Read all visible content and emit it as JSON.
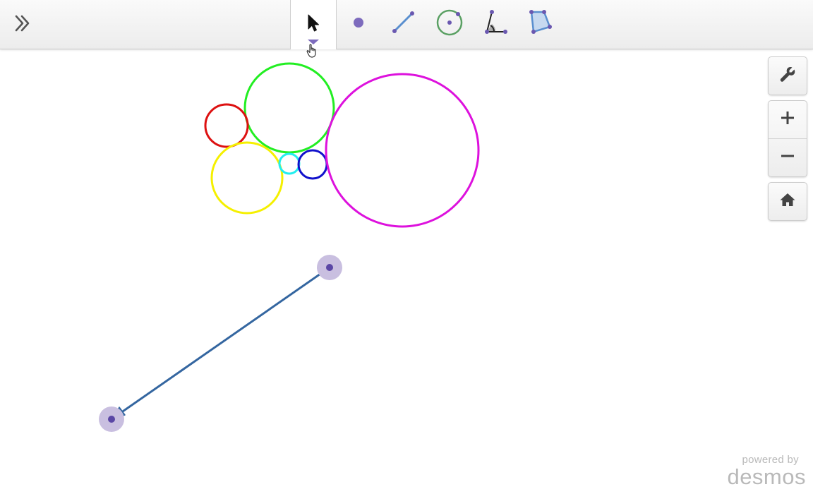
{
  "toolbar": {
    "expand_icon": "double-chevron-right-icon",
    "tools": [
      {
        "name": "select",
        "icon": "arrow-pointer-icon",
        "selected": true
      },
      {
        "name": "point",
        "icon": "point-icon"
      },
      {
        "name": "segment",
        "icon": "segment-icon"
      },
      {
        "name": "circle",
        "icon": "circle-icon"
      },
      {
        "name": "angle",
        "icon": "angle-icon"
      },
      {
        "name": "polygon",
        "icon": "polygon-icon"
      }
    ]
  },
  "controls": {
    "settings_icon": "wrench-icon",
    "zoom_in_icon": "plus-icon",
    "zoom_out_icon": "minus-icon",
    "home_icon": "home-icon"
  },
  "colors": {
    "accent": "#7d6bbd",
    "point": "#5a46a5",
    "point_halo": "#c9bfe0",
    "vector": "#3466a0",
    "red": "#dd1111",
    "green": "#22ee22",
    "yellow": "#f5f000",
    "cyan": "#22eeee",
    "blue": "#1111cc",
    "magenta": "#dd11dd"
  },
  "watermark": {
    "powered_by": "powered by",
    "brand": "desmos"
  }
}
